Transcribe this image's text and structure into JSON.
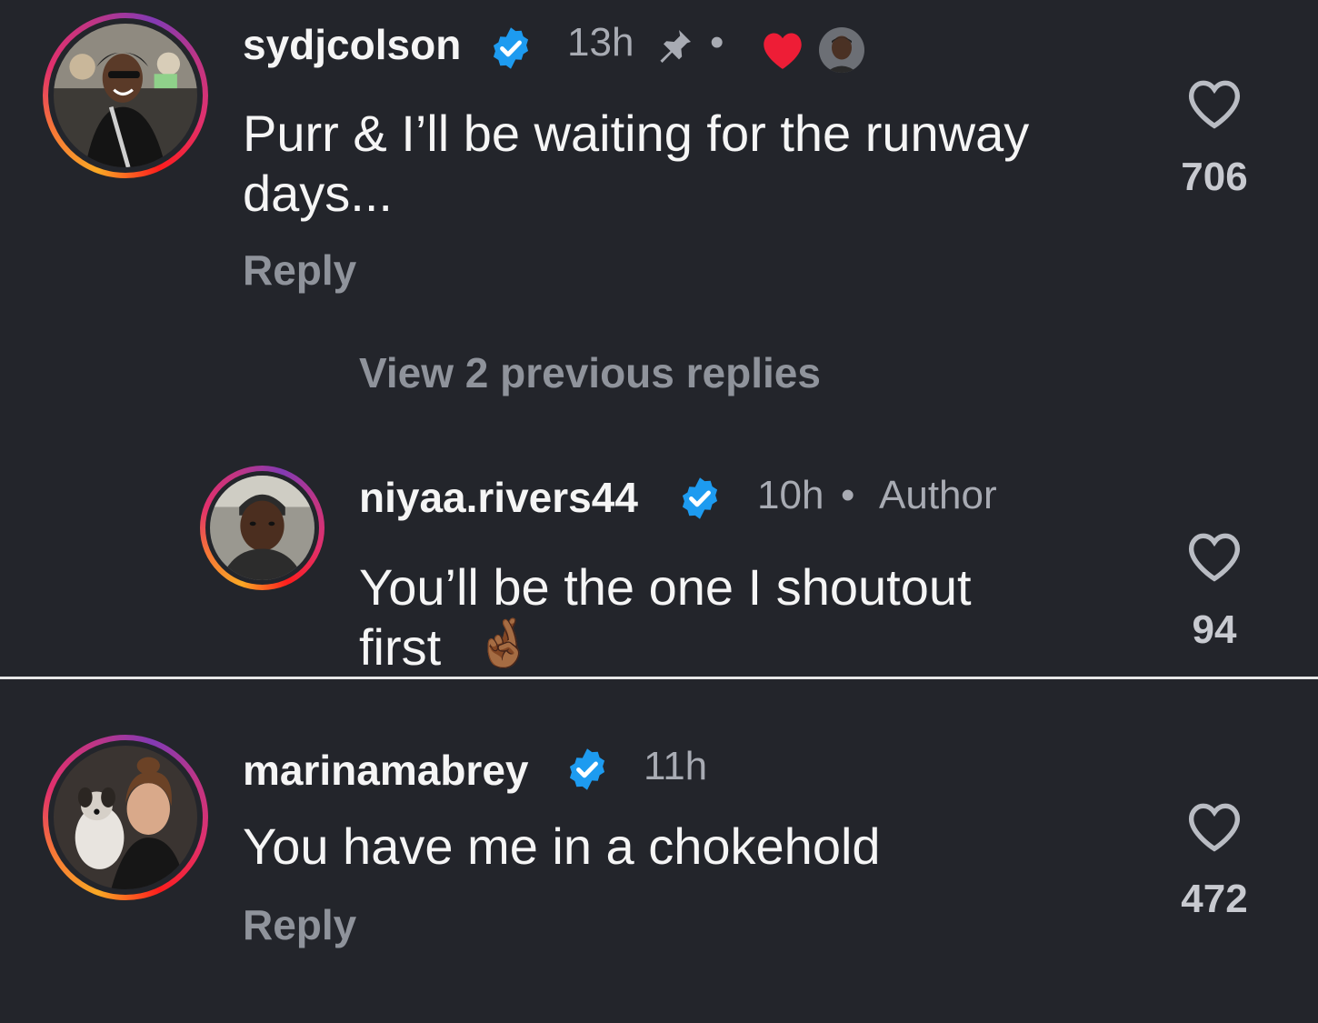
{
  "colors": {
    "background": "#23252b",
    "verified": "#1d9bf0",
    "liked_heart": "#ee1d36",
    "muted_text": "#a8abb3"
  },
  "comments": [
    {
      "username": "sydjcolson",
      "verified_icon": "verified-badge-icon",
      "time": "13h",
      "pinned_icon": "pin-icon",
      "separator": "•",
      "creator_liked_icon": "heart-filled-icon",
      "text_line1": "Purr & I’ll be waiting for the runway",
      "text_line2": "days...",
      "reply_label": "Reply",
      "like_count": "706"
    },
    {
      "username": "marinamabrey",
      "verified_icon": "verified-badge-icon",
      "time": "11h",
      "text": "You have me in a chokehold",
      "reply_label": "Reply",
      "like_count": "472"
    }
  ],
  "view_replies": "View 2 previous replies",
  "reply": {
    "username": "niyaa.rivers44",
    "verified_icon": "verified-badge-icon",
    "time": "10h",
    "separator": "•",
    "author_label": "Author",
    "text_line1": "You’ll be the one I shoutout",
    "text_line2": "first",
    "emoji": "🤞🏾",
    "like_count": "94"
  }
}
